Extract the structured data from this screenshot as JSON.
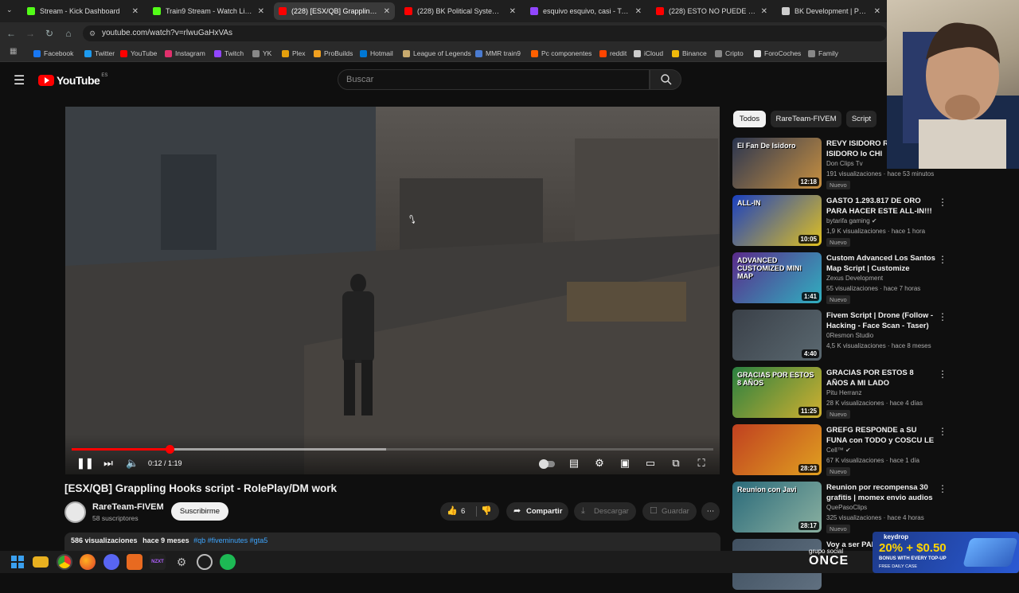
{
  "browser": {
    "tabs": [
      {
        "title": "Stream - Kick Dashboard",
        "icon": "kick-icon",
        "color": "#53fc18"
      },
      {
        "title": "Train9 Stream - Watch Live on Kick",
        "icon": "kick-icon",
        "color": "#53fc18"
      },
      {
        "title": "(228) [ESX/QB] Grappling Hooks",
        "icon": "youtube-icon",
        "color": "#ff0000"
      },
      {
        "title": "(228) BK Political System - The",
        "icon": "youtube-icon",
        "color": "#ff0000"
      },
      {
        "title": "esquivo esquivo, casi - Twitch",
        "icon": "twitch-icon",
        "color": "#9146ff"
      },
      {
        "title": "(228) ESTO NO PUEDE SER REAL",
        "icon": "youtube-icon",
        "color": "#ff0000"
      },
      {
        "title": "BK Development | Political Sys",
        "icon": "globe-icon",
        "color": "#cccccc"
      }
    ],
    "url": "youtube.com/watch?v=rlwuGaHxVAs",
    "bookmarks": [
      {
        "label": "Facebook",
        "color": "#1877f2"
      },
      {
        "label": "Twitter",
        "color": "#1d9bf0"
      },
      {
        "label": "YouTube",
        "color": "#ff0000"
      },
      {
        "label": "Instagram",
        "color": "#e1306c"
      },
      {
        "label": "Twitch",
        "color": "#9146ff"
      },
      {
        "label": "YK",
        "color": "#888888"
      },
      {
        "label": "Plex",
        "color": "#e5a00d"
      },
      {
        "label": "ProBuilds",
        "color": "#f0a020"
      },
      {
        "label": "Hotmail",
        "color": "#0078d4"
      },
      {
        "label": "League of Legends",
        "color": "#c8aa6e"
      },
      {
        "label": "MMR train9",
        "color": "#4a7bd0"
      },
      {
        "label": "Pc componentes",
        "color": "#ff6000"
      },
      {
        "label": "reddit",
        "color": "#ff4500"
      },
      {
        "label": "iCloud",
        "color": "#cccccc"
      },
      {
        "label": "Binance",
        "color": "#f0b90b"
      },
      {
        "label": "Cripto",
        "color": "#888888"
      },
      {
        "label": "ForoCoches",
        "color": "#dddddd"
      },
      {
        "label": "Family",
        "color": "#888888"
      }
    ]
  },
  "youtube": {
    "logo_text": "YouTube",
    "logo_region": "ES",
    "search_placeholder": "Buscar"
  },
  "video": {
    "title": "[ESX/QB] Grappling Hooks script - RolePlay/DM work",
    "time_display": "0:12 / 1:19",
    "progress_fraction": 0.152,
    "buffered_fraction": 0.49,
    "channel": "RareTeam-FIVEM",
    "subscribers": "58 suscriptores",
    "subscribe_label": "Suscribirme",
    "likes": "6",
    "share_label": "Compartir",
    "download_label": "Descargar",
    "save_label": "Guardar",
    "views": "586 visualizaciones",
    "age": "hace 9 meses",
    "tags": "#qb #fiveminutes #gta5"
  },
  "chips": [
    "Todos",
    "RareTeam-FIVEM",
    "Script"
  ],
  "recommended": [
    {
      "title": "REVY ISIDORO Re de ISIDORO lo CHI",
      "channel": "Don Clips Tv",
      "meta": "191 visualizaciones · hace 53 minutos",
      "badge": "Nuevo",
      "duration": "12:18",
      "thumb_text": "El Fan De Isidoro",
      "c1": "#2a3550",
      "c2": "#c89040"
    },
    {
      "title": "GASTO 1.293.817 DE ORO PARA HACER ESTE ALL-IN!!!",
      "channel": "bytarifa gaming ✔",
      "meta": "1,9 K visualizaciones · hace 1 hora",
      "badge": "Nuevo",
      "duration": "10:05",
      "thumb_text": "ALL-IN",
      "c1": "#1a40c0",
      "c2": "#e0c020"
    },
    {
      "title": "Custom Advanced Los Santos Map Script | Customize Server'...",
      "channel": "Zexus Development",
      "meta": "55 visualizaciones · hace 7 horas",
      "badge": "Nuevo",
      "duration": "1:41",
      "thumb_text": "ADVANCED CUSTOMIZED MINI MAP",
      "c1": "#5a2a8a",
      "c2": "#30b0c0"
    },
    {
      "title": "Fivem Script | Drone (Follow - Hacking - Face Scan - Taser) ...",
      "channel": "0Resmon Studio",
      "meta": "4,5 K visualizaciones · hace 8 meses",
      "badge": "",
      "duration": "4:40",
      "thumb_text": "",
      "c1": "#3a4048",
      "c2": "#5a6870"
    },
    {
      "title": "GRACIAS POR ESTOS 8 AÑOS A MI LADO",
      "channel": "Pitu Herranz",
      "meta": "28 K visualizaciones · hace 4 días",
      "badge": "Nuevo",
      "duration": "11:25",
      "thumb_text": "GRACIAS POR ESTOS 8 AÑOS",
      "c1": "#2a8040",
      "c2": "#d0b030"
    },
    {
      "title": "GREFG RESPONDE a SU FUNA con TODO y COSCU LE ACUSA...",
      "channel": "Cell™ ✔",
      "meta": "67 K visualizaciones · hace 1 día",
      "badge": "Nuevo",
      "duration": "28:23",
      "thumb_text": "",
      "c1": "#c04020",
      "c2": "#e0a020"
    },
    {
      "title": "Reunion por recompensa 30 grafitis | momex envio audios ...",
      "channel": "QuePasoClips",
      "meta": "325 visualizaciones · hace 4 horas",
      "badge": "Nuevo",
      "duration": "28:17",
      "thumb_text": "Reunion con Javi",
      "c1": "#2a6a7a",
      "c2": "#8ab0a0"
    },
    {
      "title": "Voy a ser PAP",
      "channel": "",
      "meta": "",
      "badge": "",
      "duration": "",
      "thumb_text": "",
      "c1": "#405060",
      "c2": "#607080"
    }
  ],
  "overlays": {
    "sponsor_text": "grupo social",
    "sponsor_brand": "ONCE",
    "ad_brand": "keydrop",
    "ad_offer": "20% + $0.50",
    "ad_sub": "BONUS WITH EVERY TOP-UP",
    "ad_tag": "FREE DAILY CASE"
  }
}
